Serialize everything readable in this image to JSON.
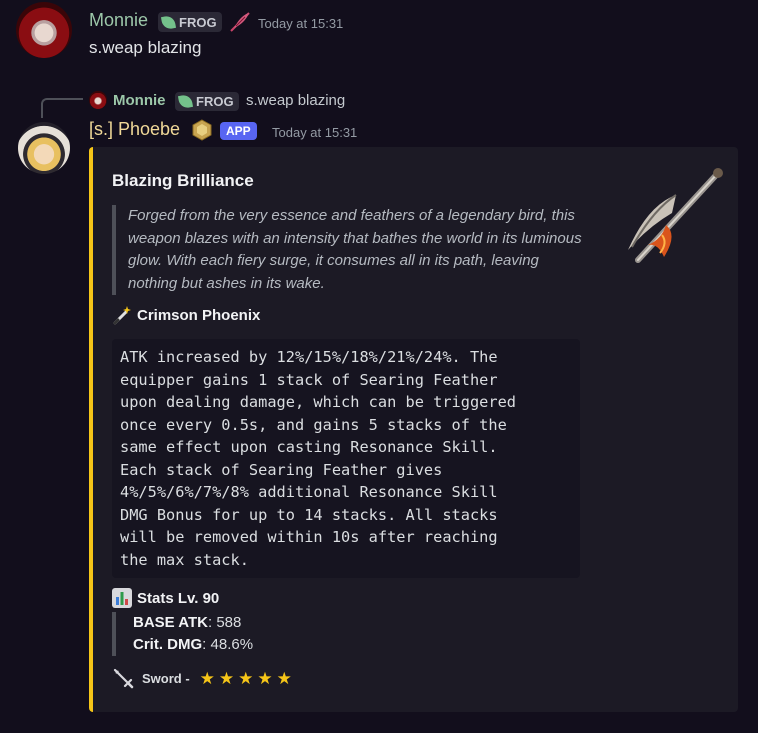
{
  "message1": {
    "author": "Monnie",
    "tag": "FROG",
    "timestamp": "Today at 15:31",
    "text": "s.weap blazing"
  },
  "reply": {
    "author": "Monnie",
    "tag": "FROG",
    "text": "s.weap blazing"
  },
  "message2": {
    "author": "[s.] Phoebe",
    "badge": "APP",
    "timestamp": "Today at 15:31"
  },
  "embed": {
    "accent_color": "#f5c518",
    "title": "Blazing Brilliance",
    "description": "Forged from the very essence and feathers of a legendary bird, this weapon blazes with an intensity that bathes the world in its luminous glow. With each fiery surge, it consumes all in its path, leaving nothing but ashes in its wake.",
    "passive_title": "Crimson Phoenix",
    "passive_icon": "magic-wand-icon",
    "passive_text": "ATK increased by 12%/15%/18%/21%/24%. The\nequipper gains 1 stack of Searing Feather\nupon dealing damage, which can be triggered\nonce every 0.5s, and gains 5 stacks of the\nsame effect upon casting Resonance Skill.\nEach stack of Searing Feather gives\n4%/5%/6%/7%/8% additional Resonance Skill\nDMG Bonus for up to 14 stacks. All stacks\nwill be removed within 10s after reaching\nthe max stack.",
    "stats_title": "Stats Lv. 90",
    "stats_icon": "bar-chart-icon",
    "stats": [
      {
        "label": "BASE ATK",
        "value": ": 588"
      },
      {
        "label": "Crit. DMG",
        "value": ": 48.6%"
      }
    ],
    "weapon_type": "Sword -",
    "weapon_icon": "sword-icon",
    "rarity_stars": 5
  }
}
